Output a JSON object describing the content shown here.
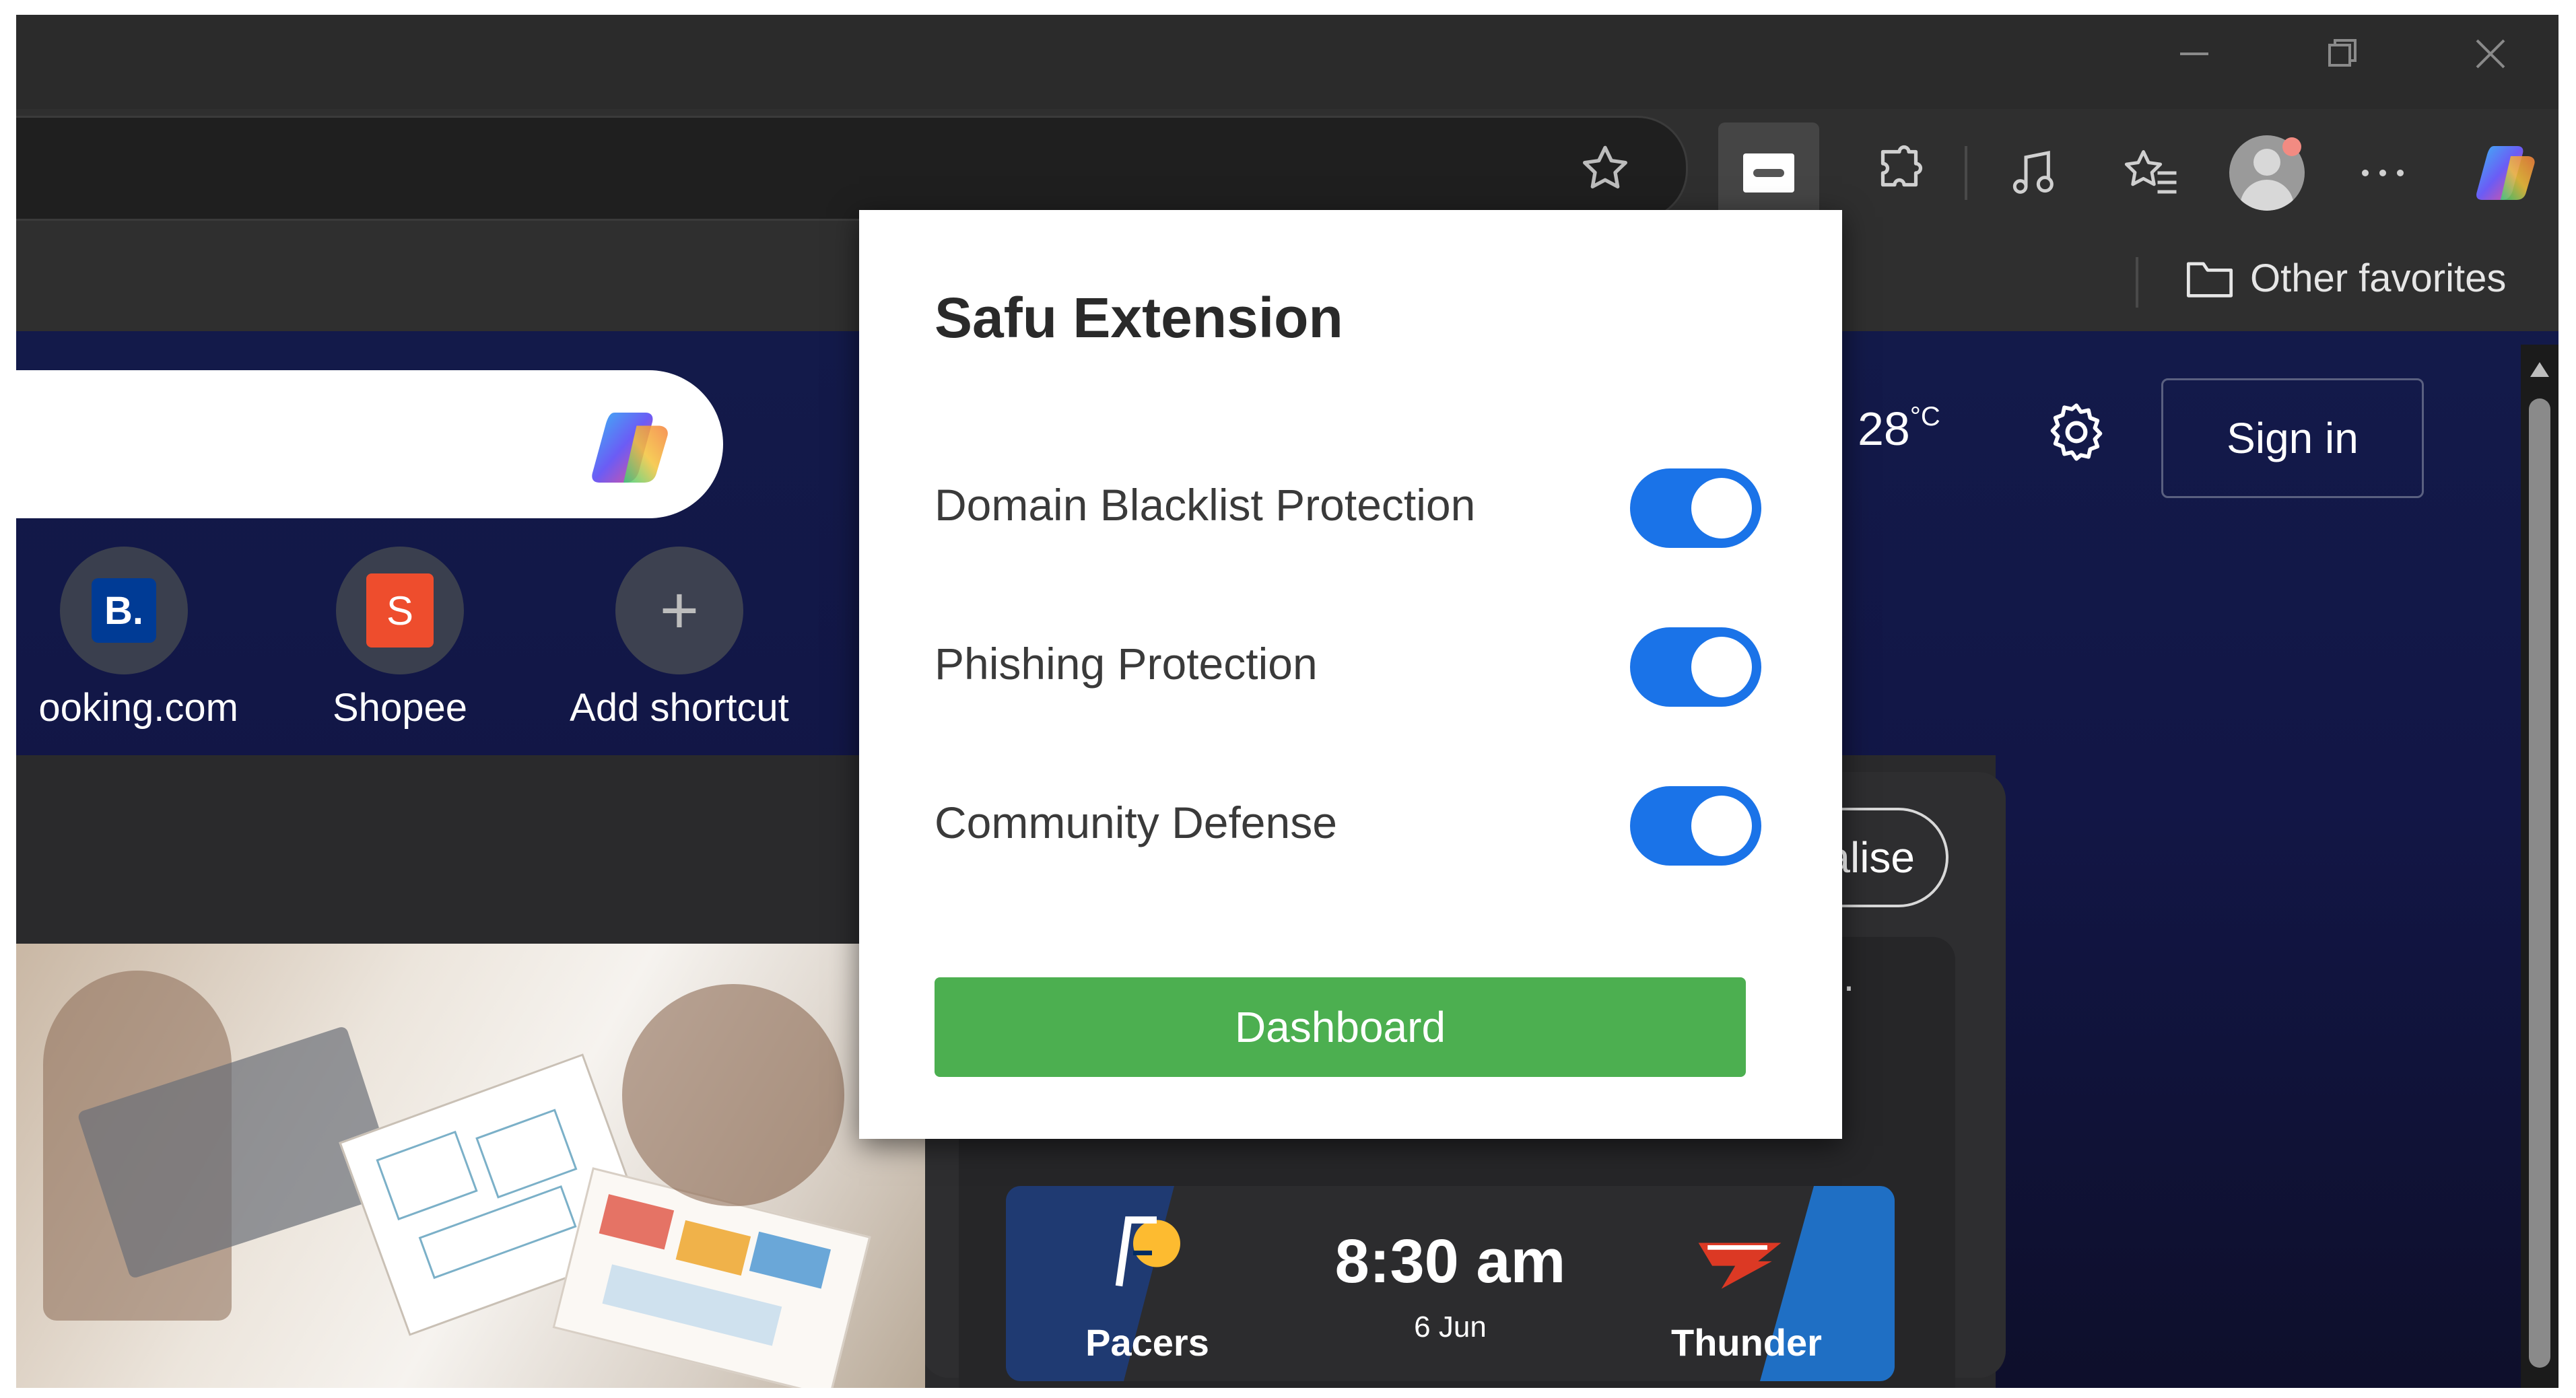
{
  "window_controls": [
    "minimize-icon",
    "restore-icon",
    "close-icon"
  ],
  "toolbar": {
    "favorite_star": "star-icon",
    "extension_icon": "safu-extension-icon",
    "icons": [
      "puzzle-extensions-icon",
      "media-control-icon",
      "favorites-icon",
      "profile-avatar-icon",
      "more-options-icon",
      "copilot-icon"
    ]
  },
  "favorites_bar": {
    "other_favorites": "Other favorites"
  },
  "new_tab": {
    "weather_temp": "28",
    "weather_unit": "°C",
    "sign_in": "Sign in",
    "personalise_partial": "alise",
    "shortcuts": [
      {
        "label": "ooking.com",
        "icon_text": "B."
      },
      {
        "label": "Shopee",
        "icon_text": "S"
      },
      {
        "label": "Add shortcut",
        "icon_text": "+"
      }
    ],
    "card_more": "···",
    "game": {
      "home_team": "Pacers",
      "away_team": "Thunder",
      "time": "8:30 am",
      "date": "6 Jun"
    }
  },
  "popup": {
    "title": "Safu Extension",
    "settings": [
      {
        "label": "Domain Blacklist Protection",
        "enabled": true
      },
      {
        "label": "Phishing Protection",
        "enabled": true
      },
      {
        "label": "Community Defense",
        "enabled": true
      }
    ],
    "dashboard_button": "Dashboard"
  },
  "colors": {
    "toggle_on": "#1a73e8",
    "dashboard_green": "#4caf50",
    "ntp_background": "#131a4a"
  }
}
